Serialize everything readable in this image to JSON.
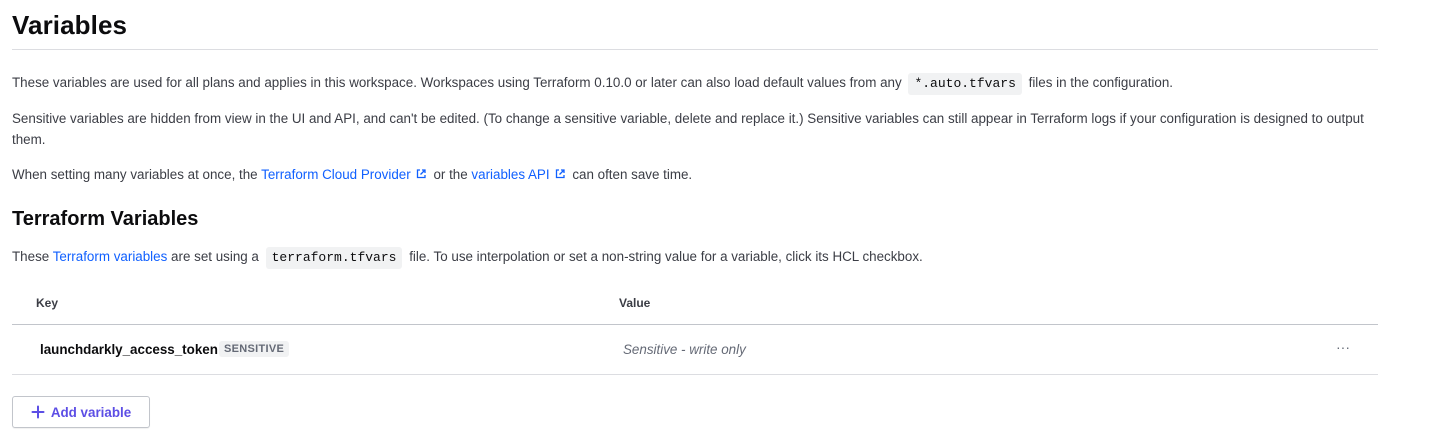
{
  "page": {
    "title": "Variables",
    "intro": {
      "p1_before": "These variables are used for all plans and applies in this workspace. Workspaces using Terraform 0.10.0 or later can also load default values from any",
      "p1_code": "*.auto.tfvars",
      "p1_after": "files in the configuration.",
      "p2": "Sensitive variables are hidden from view in the UI and API, and can't be edited. (To change a sensitive variable, delete and replace it.) Sensitive variables can still appear in Terraform logs if your configuration is designed to output them.",
      "p3_before": "When setting many variables at once, the",
      "p3_link1": "Terraform Cloud Provider",
      "p3_middle": "or the",
      "p3_link2": "variables API",
      "p3_after": "can often save time."
    }
  },
  "terraform_section": {
    "heading": "Terraform Variables",
    "desc_before": "These",
    "desc_link": "Terraform variables",
    "desc_middle": "are set using a",
    "desc_code": "terraform.tfvars",
    "desc_after": "file. To use interpolation or set a non-string value for a variable, click its HCL checkbox.",
    "table": {
      "col_key": "Key",
      "col_value": "Value",
      "rows": [
        {
          "key": "launchdarkly_access_token",
          "badge": "SENSITIVE",
          "value": "Sensitive - write only",
          "menu": "···"
        }
      ]
    },
    "add_button": "Add variable"
  },
  "icons": {
    "external_link": "external-link-icon",
    "plus": "plus-icon",
    "more": "ellipsis-icon"
  },
  "colors": {
    "link": "#1060ff",
    "button_text": "#5c4ee5"
  }
}
